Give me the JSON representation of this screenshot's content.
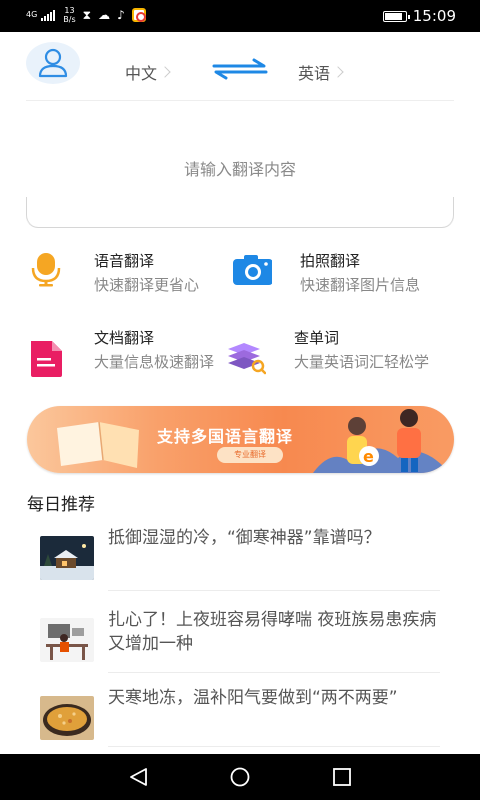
{
  "status_bar": {
    "network": "4G",
    "speed_value": "13",
    "speed_unit": "B/s",
    "time": "15:09",
    "icons": [
      "signal-icon",
      "hourglass-icon",
      "cloud-icon",
      "tiktok-icon",
      "app-icon",
      "battery-icon"
    ]
  },
  "header": {
    "source_language": "中文",
    "target_language": "英语",
    "icons": [
      "user-icon",
      "swap-arrows-icon",
      "chevron-right-icon"
    ]
  },
  "input": {
    "placeholder": "请输入翻译内容"
  },
  "features": [
    {
      "title": "语音翻译",
      "desc": "快速翻译更省心",
      "icon": "microphone-icon",
      "color": "#f5a623"
    },
    {
      "title": "拍照翻译",
      "desc": "快速翻译图片信息",
      "icon": "camera-icon",
      "color": "#1e88e5"
    },
    {
      "title": "文档翻译",
      "desc": "大量信息极速翻译",
      "icon": "document-icon",
      "color": "#e91e63"
    },
    {
      "title": "查单词",
      "desc": "大量英语词汇轻松学",
      "icon": "book-search-icon",
      "color": "#9c6ade"
    }
  ],
  "banner": {
    "title": "支持多国语言翻译",
    "button_label": "专业翻译"
  },
  "daily": {
    "title": "每日推荐",
    "items": [
      {
        "text": "抵御湿湿的冷，“御寒神器”靠谱吗？",
        "thumb": "snow-house-thumbnail"
      },
      {
        "text": "扎心了！上夜班容易得哮喘 夜班族易患疾病又增加一种",
        "thumb": "night-shift-thumbnail"
      },
      {
        "text": "天寒地冻，温补阳气要做到“两不两要”",
        "thumb": "soup-thumbnail"
      }
    ]
  },
  "nav": {
    "icons": [
      "back-icon",
      "home-icon",
      "recents-icon"
    ]
  },
  "colors": {
    "accent_blue": "#1e88e5",
    "banner_orange": "#f7894f",
    "placeholder_gray": "#8a8a8a"
  }
}
